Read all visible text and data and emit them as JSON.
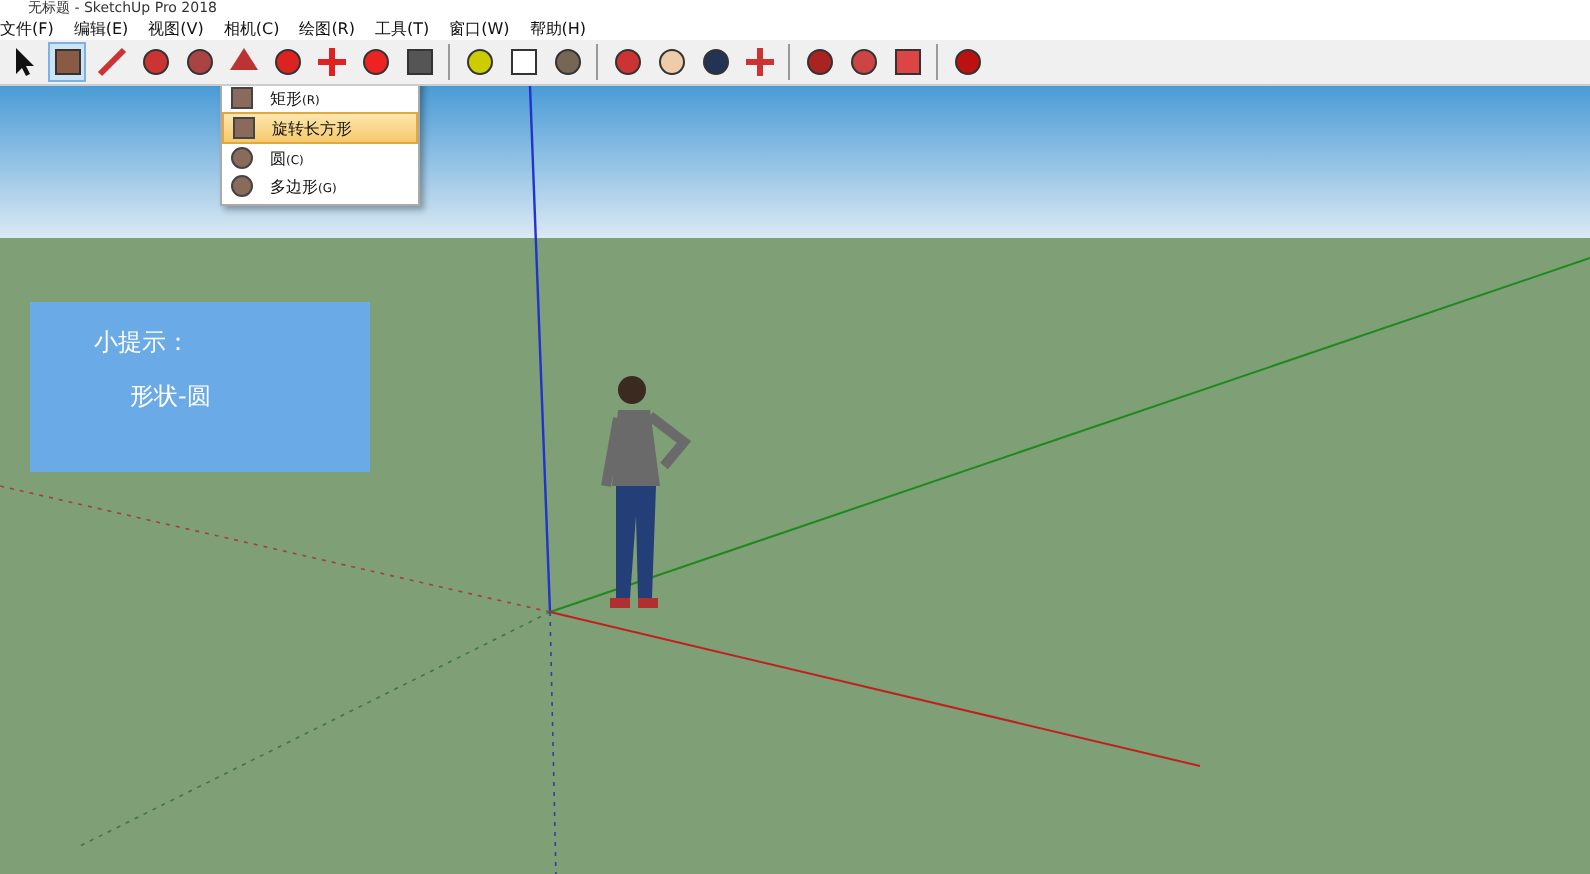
{
  "window": {
    "title": "无标题 - SketchUp Pro 2018"
  },
  "menu_bar": [
    "文件(F)",
    "编辑(E)",
    "视图(V)",
    "相机(C)",
    "绘图(R)",
    "工具(T)",
    "窗口(W)",
    "帮助(H)"
  ],
  "dropdown": {
    "items": [
      {
        "label": "矩形",
        "shortcut": "(R)",
        "selected": false
      },
      {
        "label": "旋转长方形",
        "selected": true
      },
      {
        "label": "圆",
        "shortcut": "(C)",
        "selected": false
      },
      {
        "label": "多边形",
        "shortcut": "(G)",
        "selected": false
      }
    ]
  },
  "hint_card": {
    "title": "小提示：",
    "text": "形状-圆"
  }
}
